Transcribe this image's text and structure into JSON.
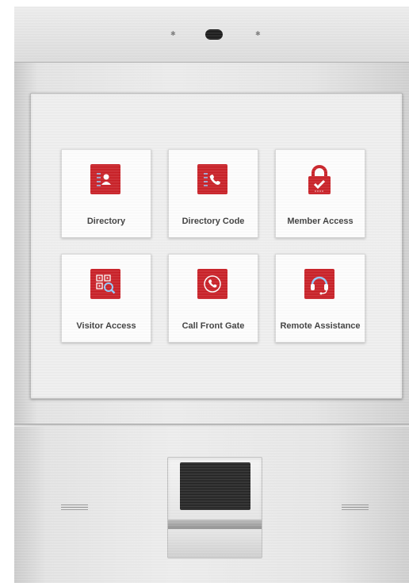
{
  "device": {
    "accent_color": "#c8161d",
    "hardware": [
      "camera-icon",
      "led-indicator",
      "speaker-grille",
      "card-reader"
    ]
  },
  "menu": {
    "tiles": [
      {
        "label": "Directory",
        "icon": "contact-book-icon"
      },
      {
        "label": "Directory Code",
        "icon": "phone-book-icon"
      },
      {
        "label": "Member Access",
        "icon": "padlock-check-icon"
      },
      {
        "label": "Visitor Access",
        "icon": "qr-code-search-icon"
      },
      {
        "label": "Call Front Gate",
        "icon": "phone-call-icon"
      },
      {
        "label": "Remote Assistance",
        "icon": "headset-icon"
      }
    ]
  }
}
